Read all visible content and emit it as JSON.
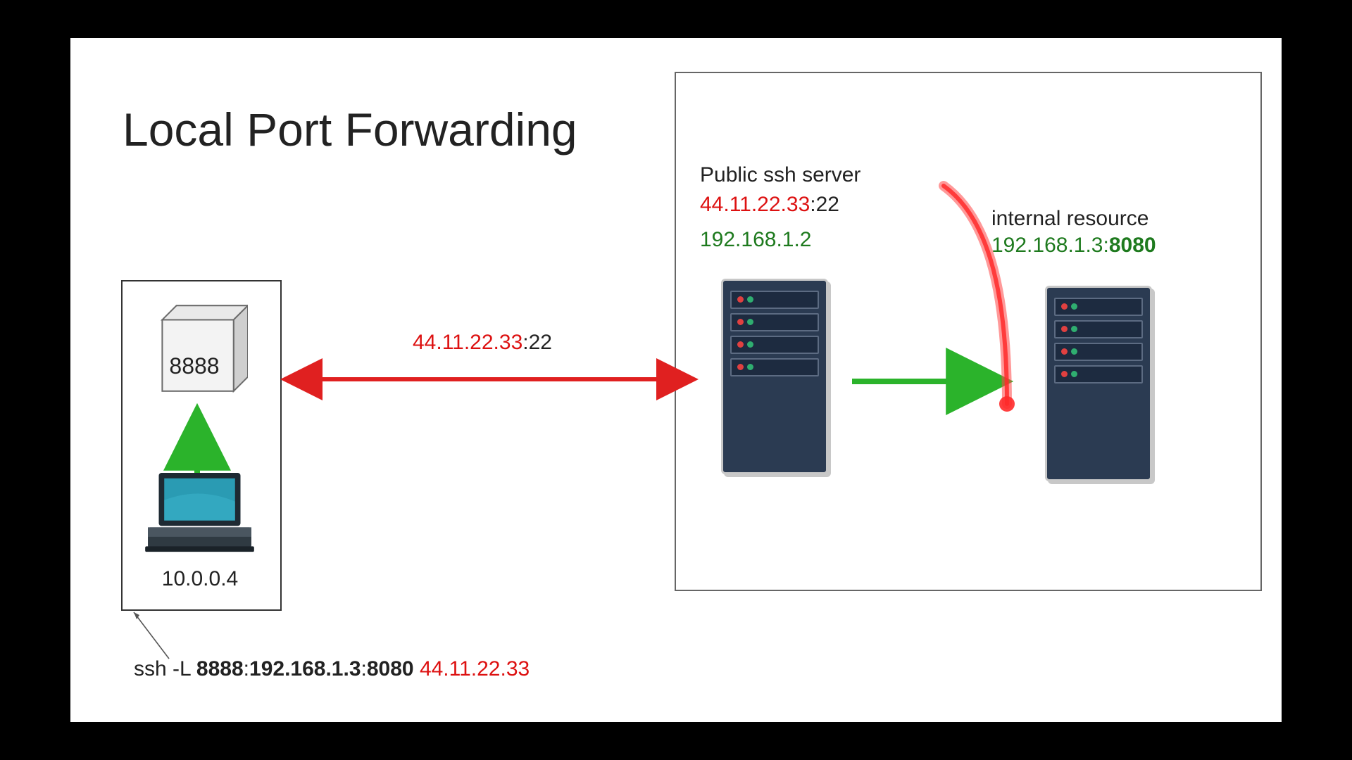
{
  "title": "Local Port Forwarding",
  "client": {
    "local_port": "8888",
    "ip": "10.0.0.4"
  },
  "ssh_path": {
    "ip": "44.11.22.33",
    "port": ":22"
  },
  "ssh_server": {
    "label": "Public ssh server",
    "public_ip": "44.11.22.33",
    "public_port": ":22",
    "lan_ip": "192.168.1.2"
  },
  "internal": {
    "label": "internal resource",
    "ip": "192.168.1.3:",
    "port": "8080"
  },
  "cmd": {
    "prefix": "ssh -L ",
    "lport": "8888",
    "sep1": ":",
    "target_ip": "192.168.1.3",
    "sep2": ":",
    "target_port": "8080",
    "space": " ",
    "host": "44.11.22.33"
  },
  "colors": {
    "red": "#d11",
    "green": "#2bb32b",
    "dark": "#222",
    "server_fill": "#2b3b52"
  }
}
